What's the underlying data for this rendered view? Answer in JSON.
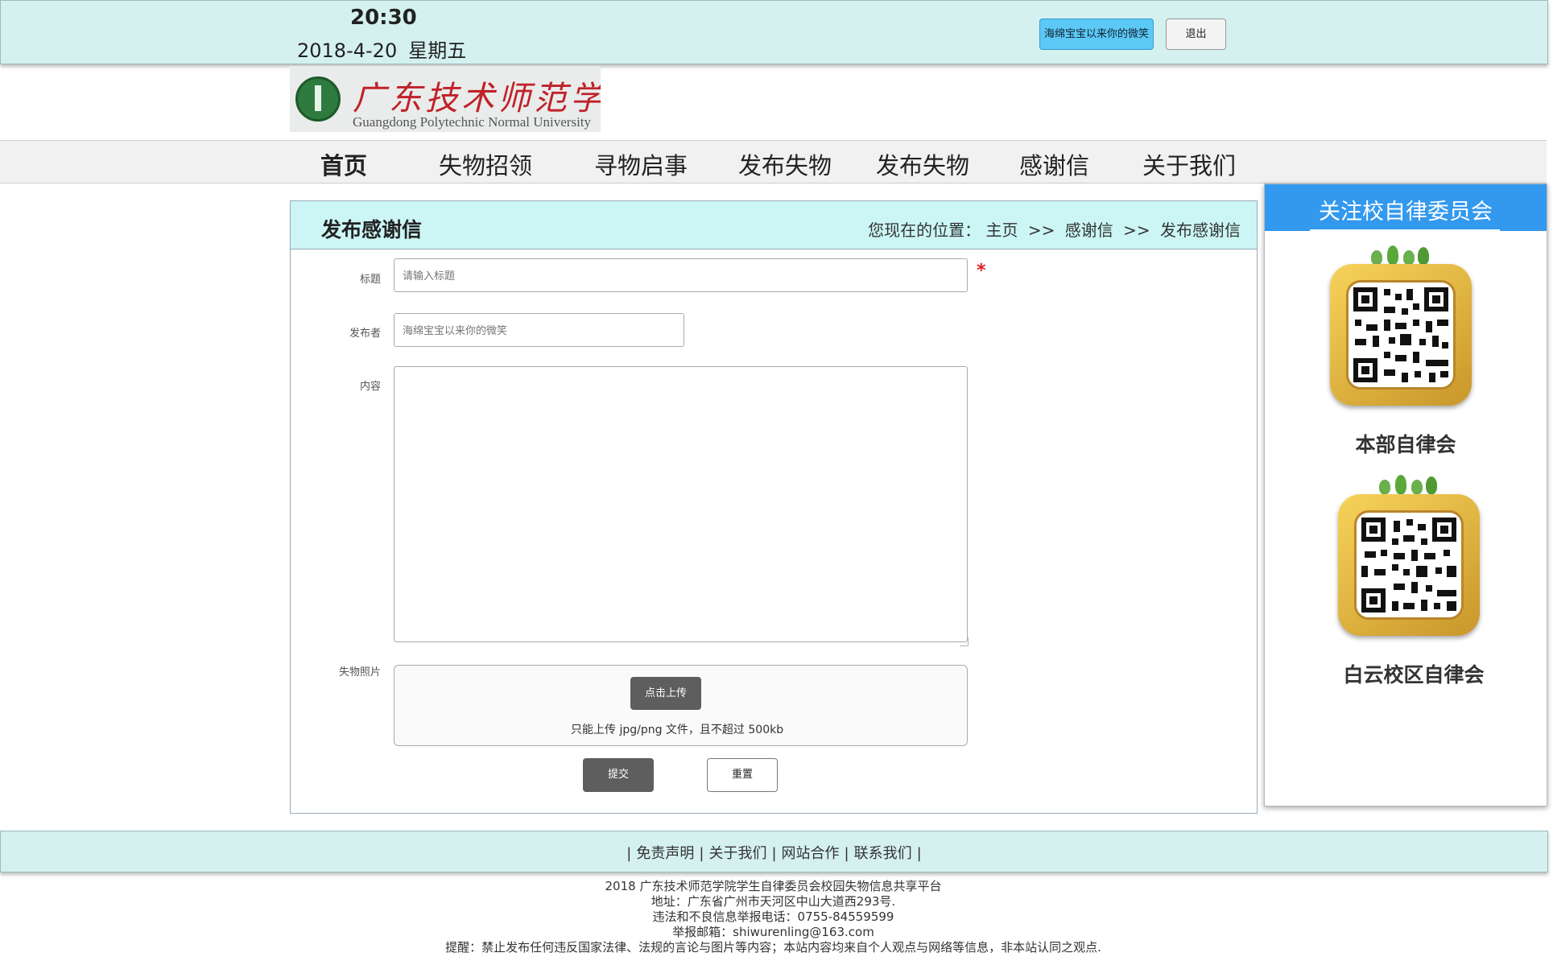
{
  "topbar": {
    "time": "20:30",
    "date": "2018-4-20",
    "weekday": "星期五",
    "user_button": "海绵宝宝以来你的微笑",
    "logout": "退出"
  },
  "logo": {
    "cn": "广东技术师范学院",
    "en": "Guangdong Polytechnic Normal University"
  },
  "nav": [
    "首页",
    "失物招领",
    "寻物启事",
    "发布失物",
    "发布失物",
    "感谢信",
    "关于我们"
  ],
  "panel": {
    "title": "发布感谢信",
    "crumb_prefix": "您现在的位置：",
    "crumbs": [
      "主页",
      ">>",
      "感谢信",
      ">>",
      "发布感谢信"
    ]
  },
  "form": {
    "title_label": "标题",
    "title_placeholder": "请输入标题",
    "required_mark": "*",
    "author_label": "发布者",
    "author_placeholder": "海绵宝宝以来你的微笑",
    "content_label": "内容",
    "photo_label": "失物照片",
    "upload_button": "点击上传",
    "upload_hint": "只能上传 jpg/png 文件，且不超过 500kb",
    "submit": "提交",
    "reset": "重置"
  },
  "sidebar": {
    "title": "关注校自律委员会",
    "qr1_label": "本部自律会",
    "qr2_label": "白云校区自律会"
  },
  "footer": {
    "links": [
      "免责声明",
      "关于我们",
      "网站合作",
      "联系我们"
    ],
    "lines": [
      "2018 广东技术师范学院学生自律委员会校园失物信息共享平台",
      "地址：广东省广州市天河区中山大道西293号.",
      "违法和不良信息举报电话：0755-84559599",
      "举报邮箱：shiwurenling@163.com",
      "提醒：禁止发布任何违反国家法律、法规的言论与图片等内容；本站内容均来自个人观点与网络等信息，非本站认同之观点."
    ]
  },
  "colors": {
    "topbar_bg": "#d4f1ef",
    "panel_head_bg": "#cbf6f5",
    "sidebar_head_bg": "#3399ee",
    "user_button_bg": "#5bc8f5",
    "required": "#e02020"
  }
}
